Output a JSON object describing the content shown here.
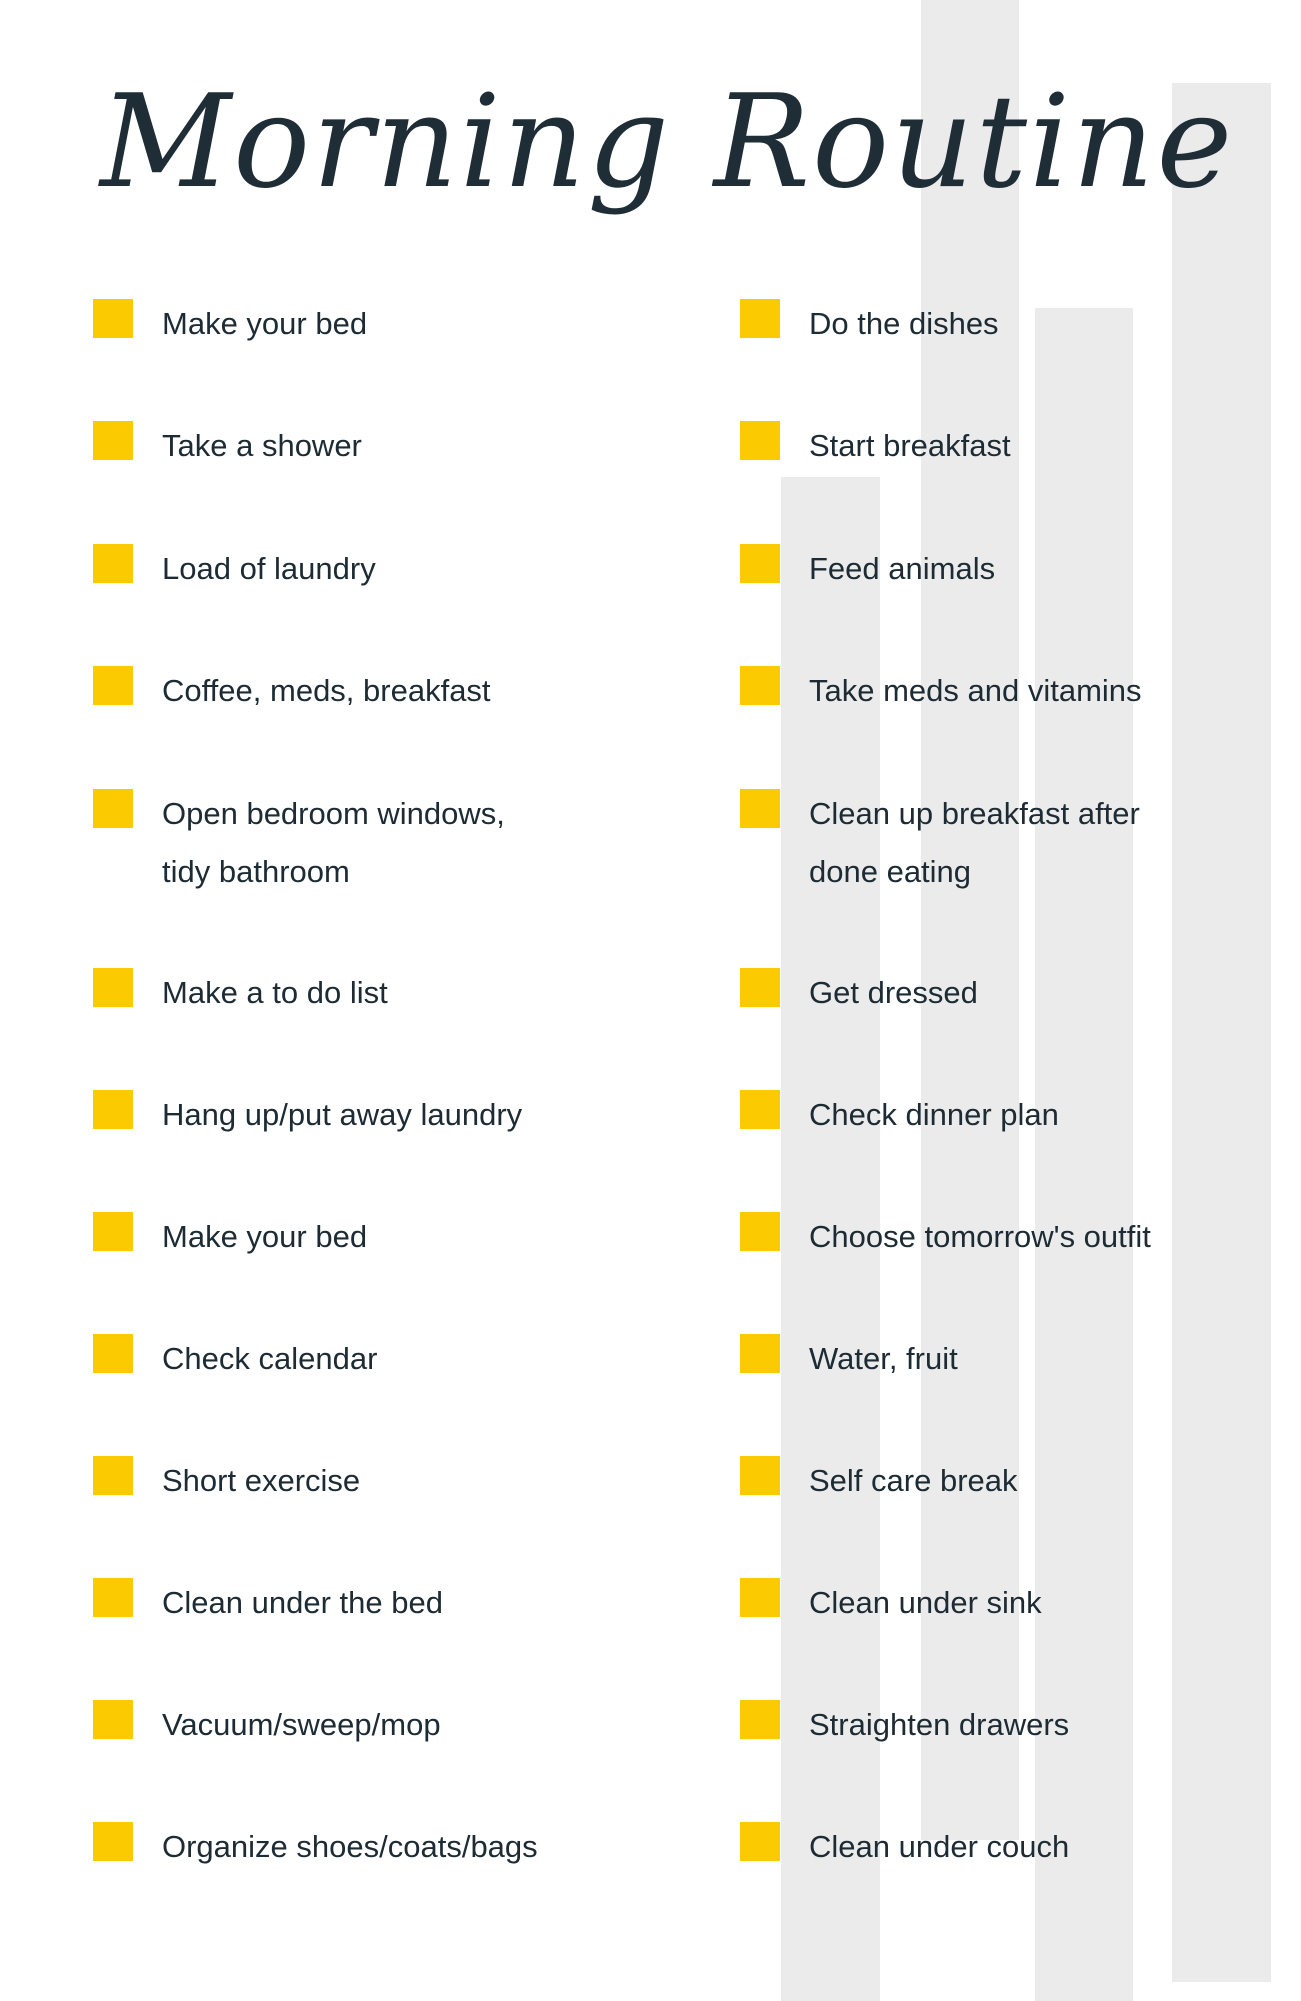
{
  "title": "Morning Routine",
  "colors": {
    "checkbox": "#fcca00",
    "text": "#1d2b34",
    "bars": "#ebebeb"
  },
  "left_items": [
    {
      "lines": [
        "Make your bed"
      ]
    },
    {
      "lines": [
        "Take a shower"
      ]
    },
    {
      "lines": [
        "Load of laundry"
      ]
    },
    {
      "lines": [
        "Coffee, meds, breakfast"
      ]
    },
    {
      "lines": [
        "Open bedroom windows,",
        "tidy bathroom"
      ]
    },
    {
      "lines": [
        "Make a to do list"
      ]
    },
    {
      "lines": [
        "Hang up/put away laundry"
      ]
    },
    {
      "lines": [
        "Make your bed"
      ]
    },
    {
      "lines": [
        "Check calendar"
      ]
    },
    {
      "lines": [
        "Short exercise"
      ]
    },
    {
      "lines": [
        "Clean under the bed"
      ]
    },
    {
      "lines": [
        "Vacuum/sweep/mop"
      ]
    },
    {
      "lines": [
        "Organize shoes/coats/bags"
      ]
    }
  ],
  "right_items": [
    {
      "lines": [
        "Do the dishes"
      ]
    },
    {
      "lines": [
        "Start breakfast"
      ]
    },
    {
      "lines": [
        "Feed animals"
      ]
    },
    {
      "lines": [
        "Take meds and vitamins"
      ]
    },
    {
      "lines": [
        "Clean up breakfast after",
        "done eating"
      ]
    },
    {
      "lines": [
        "Get dressed"
      ]
    },
    {
      "lines": [
        "Check dinner plan"
      ]
    },
    {
      "lines": [
        "Choose tomorrow's outfit"
      ]
    },
    {
      "lines": [
        "Water, fruit"
      ]
    },
    {
      "lines": [
        "Self care break"
      ]
    },
    {
      "lines": [
        "Clean under sink"
      ]
    },
    {
      "lines": [
        "Straighten drawers"
      ]
    },
    {
      "lines": [
        "Clean under couch"
      ]
    }
  ]
}
